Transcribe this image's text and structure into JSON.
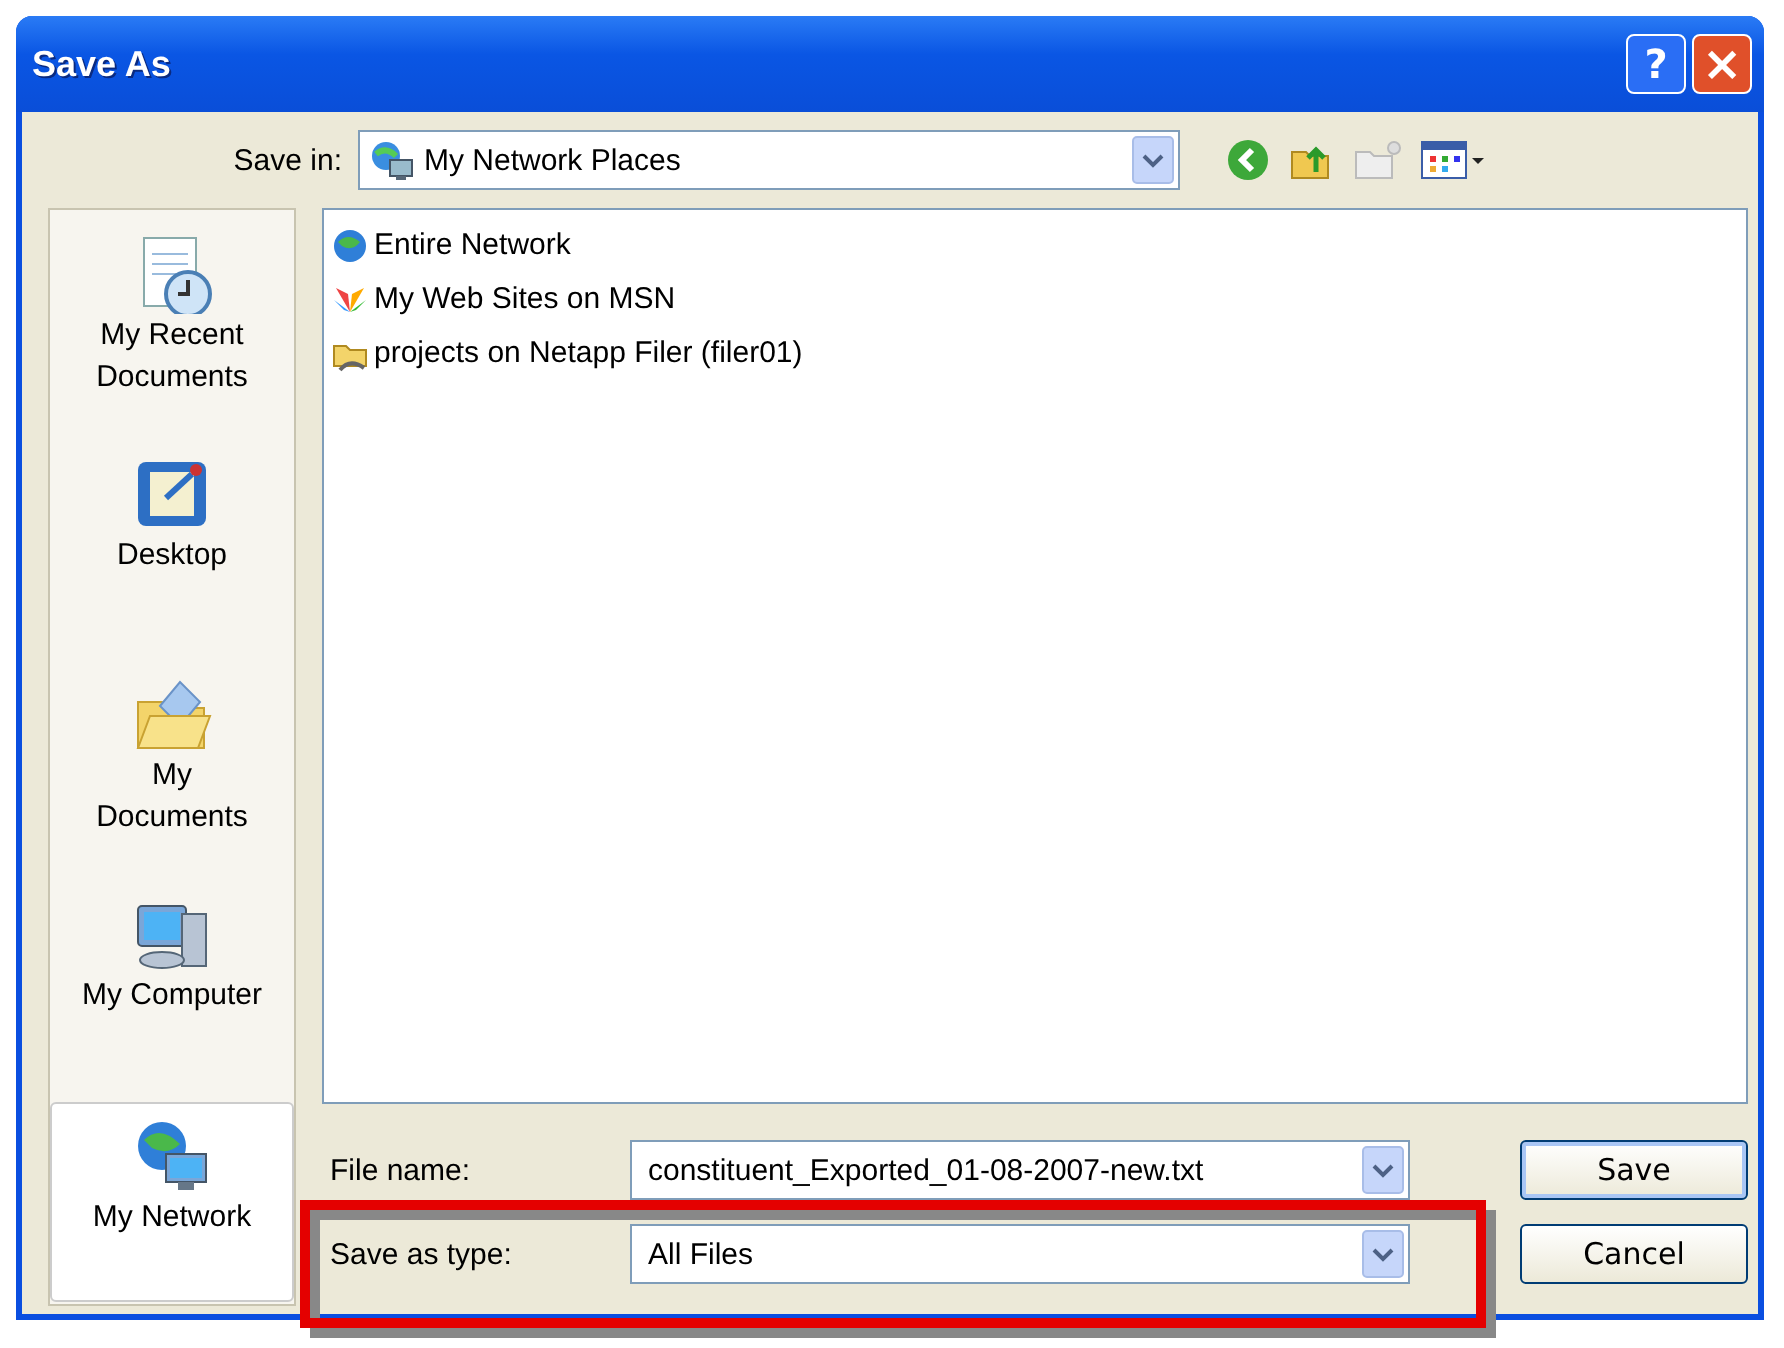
{
  "window": {
    "title": "Save As"
  },
  "title_buttons": [
    {
      "kind": "help",
      "label": "?"
    },
    {
      "kind": "close",
      "label": "×"
    }
  ],
  "save_in": {
    "label": "Save in:",
    "value": "My Network Places"
  },
  "places": [
    {
      "kind": "recent",
      "label": "My Recent Documents",
      "selected": false
    },
    {
      "kind": "desktop",
      "label": "Desktop",
      "selected": false
    },
    {
      "kind": "documents",
      "label": "My Documents",
      "selected": false
    },
    {
      "kind": "computer",
      "label": "My Computer",
      "selected": false
    },
    {
      "kind": "network",
      "label": "My Network",
      "selected": true
    }
  ],
  "files": [
    {
      "kind": "globe",
      "name": "Entire Network"
    },
    {
      "kind": "msn",
      "name": "My Web Sites on MSN"
    },
    {
      "kind": "share",
      "name": "projects on Netapp Filer (filer01)"
    }
  ],
  "file_name": {
    "label": "File name:",
    "value": "constituent_Exported_01-08-2007-new.txt"
  },
  "save_as_type": {
    "label": "Save as type:",
    "value": "All Files",
    "highlighted": true
  },
  "buttons": [
    {
      "label": "Save",
      "default": true
    },
    {
      "label": "Cancel",
      "default": false
    }
  ]
}
